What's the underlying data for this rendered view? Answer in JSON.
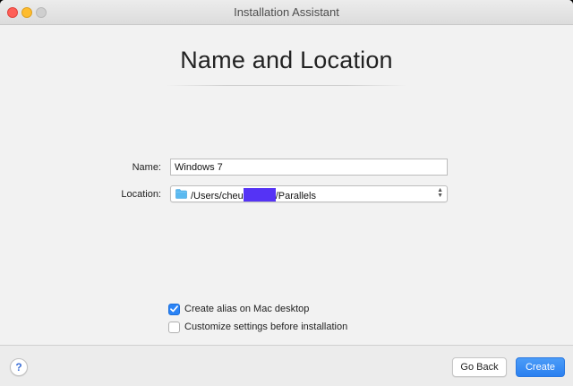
{
  "window": {
    "title": "Installation Assistant"
  },
  "page": {
    "title": "Name and Location"
  },
  "form": {
    "name_label": "Name:",
    "name_value": "Windows 7",
    "location_label": "Location:",
    "location_prefix": "/Users/cheu",
    "location_suffix": "/Parallels",
    "location_icon": "folder-icon"
  },
  "options": [
    {
      "label": "Create alias on Mac desktop",
      "checked": true
    },
    {
      "label": "Customize settings before installation",
      "checked": false
    }
  ],
  "footer": {
    "help_label": "?",
    "back_label": "Go Back",
    "create_label": "Create"
  },
  "colors": {
    "accent": "#2a83f6",
    "redaction": "#5533f5",
    "folder": "#5ab9f0"
  }
}
